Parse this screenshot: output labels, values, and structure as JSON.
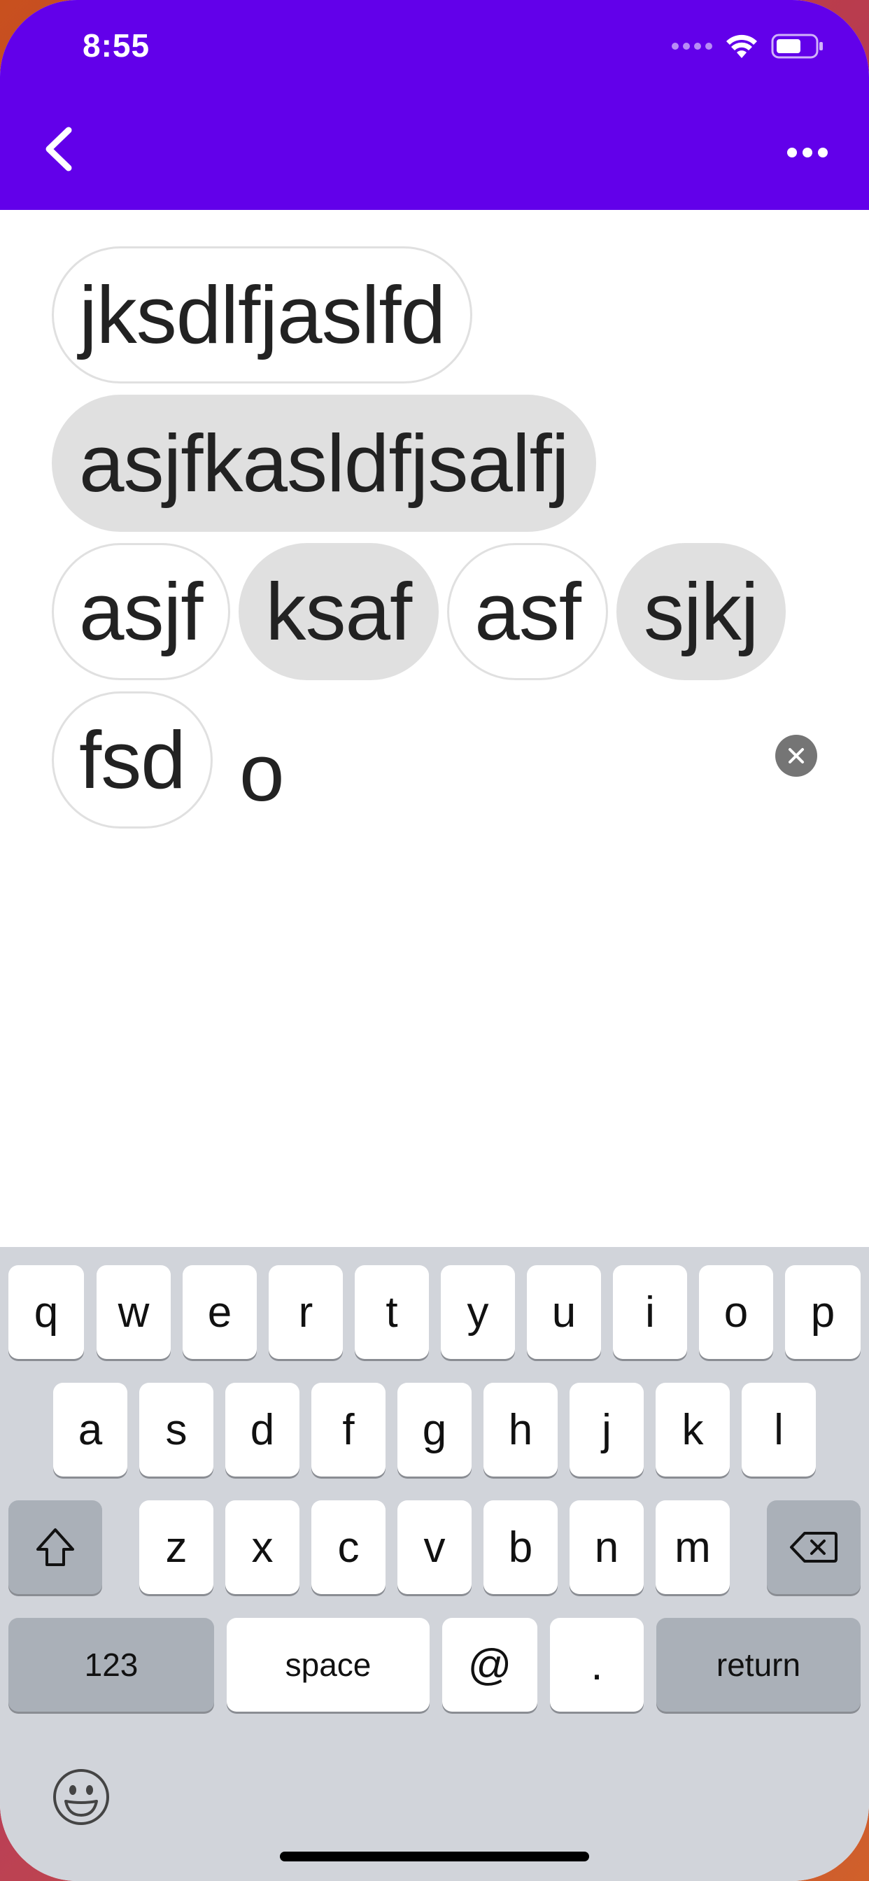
{
  "status_bar": {
    "time": "8:55"
  },
  "header": {
    "back_icon": "chevron-left-icon",
    "more_icon": "more-horizontal-icon",
    "color": "#6200ea"
  },
  "chips": [
    {
      "label": "jksdlfjaslfd",
      "style": "outlined"
    },
    {
      "label": "asjfkasldfjsalfj",
      "style": "filled"
    },
    {
      "label": "asjf",
      "style": "outlined"
    },
    {
      "label": "ksaf",
      "style": "filled"
    },
    {
      "label": "asf",
      "style": "outlined"
    },
    {
      "label": "sjkj",
      "style": "filled"
    },
    {
      "label": "fsd",
      "style": "outlined"
    }
  ],
  "input": {
    "value": "o",
    "clear_icon": "clear-icon"
  },
  "keyboard": {
    "row1": [
      "q",
      "w",
      "e",
      "r",
      "t",
      "y",
      "u",
      "i",
      "o",
      "p"
    ],
    "row2": [
      "a",
      "s",
      "d",
      "f",
      "g",
      "h",
      "j",
      "k",
      "l"
    ],
    "row3": [
      "z",
      "x",
      "c",
      "v",
      "b",
      "n",
      "m"
    ],
    "shift_icon": "shift-icon",
    "delete_icon": "backspace-icon",
    "numbers_label": "123",
    "space_label": "space",
    "at_label": "@",
    "period_label": ".",
    "return_label": "return",
    "emoji_icon": "emoji-icon"
  }
}
